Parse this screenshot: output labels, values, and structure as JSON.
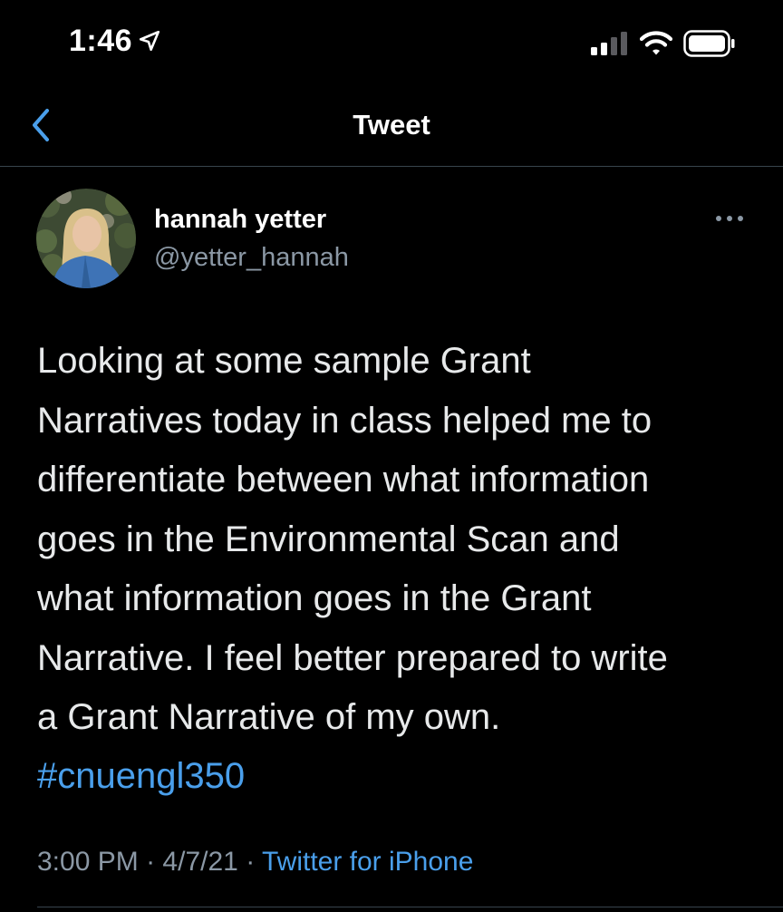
{
  "status_bar": {
    "time": "1:46",
    "location_icon": "location-arrow-icon",
    "signal_icon": "cellular-signal-icon",
    "wifi_icon": "wifi-icon",
    "battery_icon": "battery-icon"
  },
  "nav": {
    "back_icon": "chevron-left-icon",
    "title": "Tweet"
  },
  "tweet": {
    "author_name": "hannah yetter",
    "author_handle": "@yetter_hannah",
    "more_icon": "ellipsis-icon",
    "text": "Looking at some sample Grant\nNarratives today in class helped me to\ndifferentiate between what information\ngoes in the Environmental Scan and\nwhat information goes in the Grant\nNarrative. I feel better prepared to write\na Grant Narrative of my own.",
    "hashtag": "#cnuengl350",
    "time": "3:00 PM",
    "separator": "·",
    "date": "4/7/21",
    "source": "Twitter for iPhone"
  },
  "colors": {
    "background": "#000000",
    "text": "#e7e9ea",
    "secondary_text": "#8b98a5",
    "accent": "#4a9feb",
    "divider": "#38444d"
  }
}
